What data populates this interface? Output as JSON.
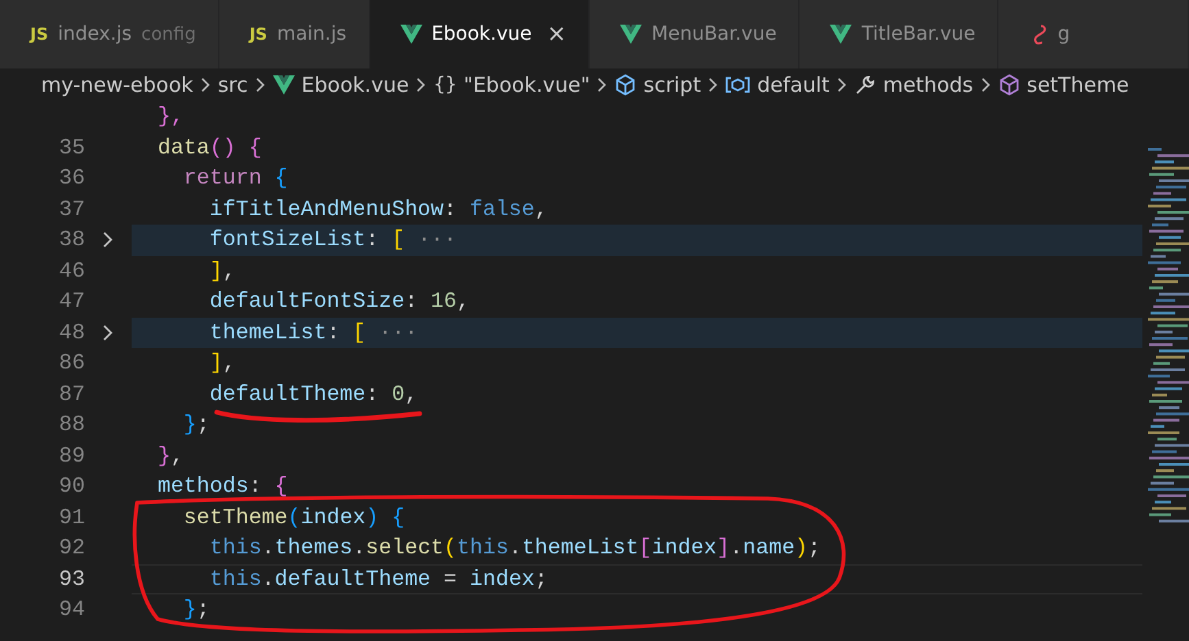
{
  "tabs": [
    {
      "label": "index.js",
      "description": "config",
      "kind": "js",
      "badge": "JS",
      "selected": false
    },
    {
      "label": "main.js",
      "kind": "js",
      "badge": "JS",
      "selected": false
    },
    {
      "label": "Ebook.vue",
      "kind": "vue",
      "selected": true,
      "close": "×"
    },
    {
      "label": "MenuBar.vue",
      "kind": "vue",
      "selected": false
    },
    {
      "label": "TitleBar.vue",
      "kind": "vue",
      "selected": false
    },
    {
      "label": "g",
      "kind": "squiggle",
      "selected": false
    }
  ],
  "breadcrumb": [
    {
      "label": "my-new-ebook",
      "kind": "plain"
    },
    {
      "label": "src",
      "kind": "plain"
    },
    {
      "label": "Ebook.vue",
      "kind": "vue"
    },
    {
      "label": "\"Ebook.vue\"",
      "kind": "text",
      "glyph": "{}"
    },
    {
      "label": "script",
      "kind": "cube"
    },
    {
      "label": "default",
      "kind": "field"
    },
    {
      "label": "methods",
      "kind": "wrench"
    },
    {
      "label": "setTheme",
      "kind": "method"
    }
  ],
  "lines": [
    {
      "folded": false,
      "current": false,
      "tokens": [
        {
          "text": "  },",
          "color": "#da70d6"
        }
      ]
    },
    {
      "number": "35",
      "folded": false,
      "current": false,
      "tokens": [
        {
          "text": "  data",
          "color": "#dcdcaa"
        },
        {
          "text": "()",
          "color": "#da70d6"
        },
        {
          "text": " {",
          "color": "#da70d6"
        }
      ]
    },
    {
      "number": "36",
      "folded": false,
      "current": false,
      "tokens": [
        {
          "text": "    return",
          "color": "#c586c0"
        },
        {
          "text": " {",
          "color": "#179fff"
        }
      ]
    },
    {
      "number": "37",
      "folded": false,
      "current": false,
      "tokens": [
        {
          "text": "      ifTitleAndMenuShow",
          "color": "#9cdcfe"
        },
        {
          "text": ": ",
          "color": "#d4d4d4"
        },
        {
          "text": "false",
          "color": "#569cd6"
        },
        {
          "text": ",",
          "color": "#d4d4d4"
        }
      ]
    },
    {
      "number": "38",
      "folded": true,
      "current": false,
      "tokens": [
        {
          "text": "      fontSizeList",
          "color": "#9cdcfe"
        },
        {
          "text": ": ",
          "color": "#d4d4d4"
        },
        {
          "text": "[",
          "color": "#ffd700"
        },
        {
          "text": " ···",
          "color": "#8c8c8c"
        }
      ]
    },
    {
      "number": "46",
      "folded": false,
      "current": false,
      "tokens": [
        {
          "text": "      ]",
          "color": "#ffd700"
        },
        {
          "text": ",",
          "color": "#d4d4d4"
        }
      ]
    },
    {
      "number": "47",
      "folded": false,
      "current": false,
      "tokens": [
        {
          "text": "      defaultFontSize",
          "color": "#9cdcfe"
        },
        {
          "text": ": ",
          "color": "#d4d4d4"
        },
        {
          "text": "16",
          "color": "#b5cea8"
        },
        {
          "text": ",",
          "color": "#d4d4d4"
        }
      ]
    },
    {
      "number": "48",
      "folded": true,
      "current": false,
      "tokens": [
        {
          "text": "      themeList",
          "color": "#9cdcfe"
        },
        {
          "text": ": ",
          "color": "#d4d4d4"
        },
        {
          "text": "[",
          "color": "#ffd700"
        },
        {
          "text": " ···",
          "color": "#8c8c8c"
        }
      ]
    },
    {
      "number": "86",
      "folded": false,
      "current": false,
      "tokens": [
        {
          "text": "      ]",
          "color": "#ffd700"
        },
        {
          "text": ",",
          "color": "#d4d4d4"
        }
      ]
    },
    {
      "number": "87",
      "folded": false,
      "current": false,
      "tokens": [
        {
          "text": "      defaultTheme",
          "color": "#9cdcfe"
        },
        {
          "text": ": ",
          "color": "#d4d4d4"
        },
        {
          "text": "0",
          "color": "#b5cea8"
        },
        {
          "text": ",",
          "color": "#d4d4d4"
        }
      ]
    },
    {
      "number": "88",
      "folded": false,
      "current": false,
      "tokens": [
        {
          "text": "    }",
          "color": "#179fff"
        },
        {
          "text": ";",
          "color": "#d4d4d4"
        }
      ]
    },
    {
      "number": "89",
      "folded": false,
      "current": false,
      "tokens": [
        {
          "text": "  }",
          "color": "#da70d6"
        },
        {
          "text": ",",
          "color": "#d4d4d4"
        }
      ]
    },
    {
      "number": "90",
      "folded": false,
      "current": false,
      "tokens": [
        {
          "text": "  methods",
          "color": "#9cdcfe"
        },
        {
          "text": ": ",
          "color": "#d4d4d4"
        },
        {
          "text": "{",
          "color": "#da70d6"
        }
      ]
    },
    {
      "number": "91",
      "folded": false,
      "current": false,
      "tokens": [
        {
          "text": "    setTheme",
          "color": "#dcdcaa"
        },
        {
          "text": "(",
          "color": "#179fff"
        },
        {
          "text": "index",
          "color": "#9cdcfe"
        },
        {
          "text": ")",
          "color": "#179fff"
        },
        {
          "text": " {",
          "color": "#179fff"
        }
      ]
    },
    {
      "number": "92",
      "folded": false,
      "current": false,
      "tokens": [
        {
          "text": "      this",
          "color": "#569cd6"
        },
        {
          "text": ".",
          "color": "#d4d4d4"
        },
        {
          "text": "themes",
          "color": "#9cdcfe"
        },
        {
          "text": ".",
          "color": "#d4d4d4"
        },
        {
          "text": "select",
          "color": "#dcdcaa"
        },
        {
          "text": "(",
          "color": "#ffd700"
        },
        {
          "text": "this",
          "color": "#569cd6"
        },
        {
          "text": ".",
          "color": "#d4d4d4"
        },
        {
          "text": "themeList",
          "color": "#9cdcfe"
        },
        {
          "text": "[",
          "color": "#da70d6"
        },
        {
          "text": "index",
          "color": "#9cdcfe"
        },
        {
          "text": "]",
          "color": "#da70d6"
        },
        {
          "text": ".",
          "color": "#d4d4d4"
        },
        {
          "text": "name",
          "color": "#9cdcfe"
        },
        {
          "text": ")",
          "color": "#ffd700"
        },
        {
          "text": ";",
          "color": "#d4d4d4"
        }
      ]
    },
    {
      "number": "93",
      "folded": false,
      "current": true,
      "tokens": [
        {
          "text": "      this",
          "color": "#569cd6"
        },
        {
          "text": ".",
          "color": "#d4d4d4"
        },
        {
          "text": "defaultTheme",
          "color": "#9cdcfe"
        },
        {
          "text": " = ",
          "color": "#d4d4d4"
        },
        {
          "text": "index",
          "color": "#9cdcfe"
        },
        {
          "text": ";",
          "color": "#d4d4d4"
        }
      ]
    },
    {
      "number": "94",
      "folded": false,
      "current": false,
      "tokens": [
        {
          "text": "    }",
          "color": "#179fff"
        },
        {
          "text": ";",
          "color": "#d4d4d4"
        }
      ]
    }
  ],
  "annotations": {
    "underline": true,
    "circle": true
  }
}
